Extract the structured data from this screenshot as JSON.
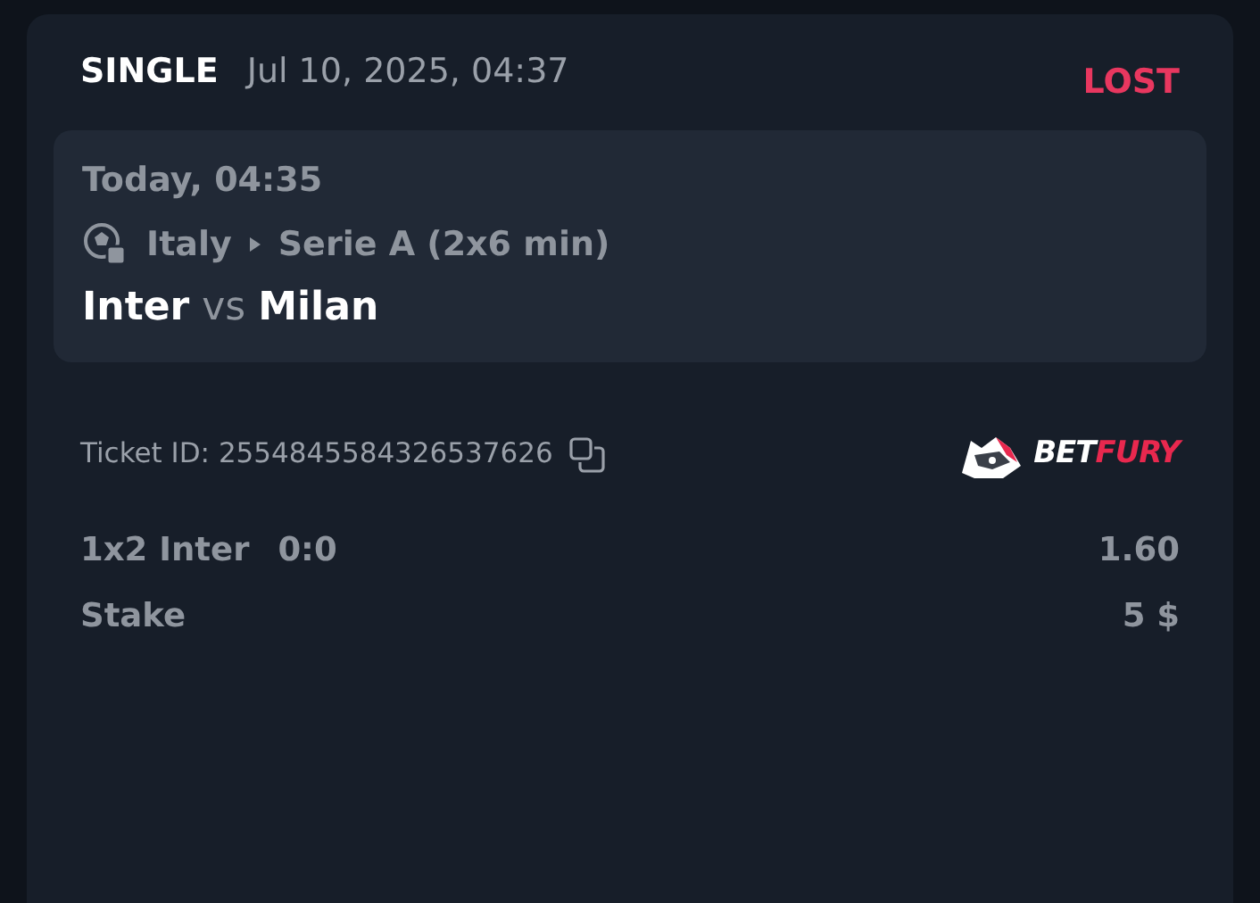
{
  "bet": {
    "type": "SINGLE",
    "placed": "Jul 10, 2025, 04:37",
    "status": {
      "text": "LOST",
      "lost": true
    }
  },
  "event": {
    "time": "Today, 04:35",
    "country": "Italy",
    "league": "Serie A (2x6 min)",
    "home": "Inter",
    "vs": "vs",
    "away": "Milan"
  },
  "ticket": {
    "label": "Ticket ID: 2554845584326537626"
  },
  "logo": {
    "part_1": "BET",
    "part_2": "FURY"
  },
  "lines": [
    {
      "label": "1x2 Inter",
      "score": "0:0",
      "value": "1.60"
    },
    {
      "label": "Stake",
      "value": "5 $"
    }
  ]
}
